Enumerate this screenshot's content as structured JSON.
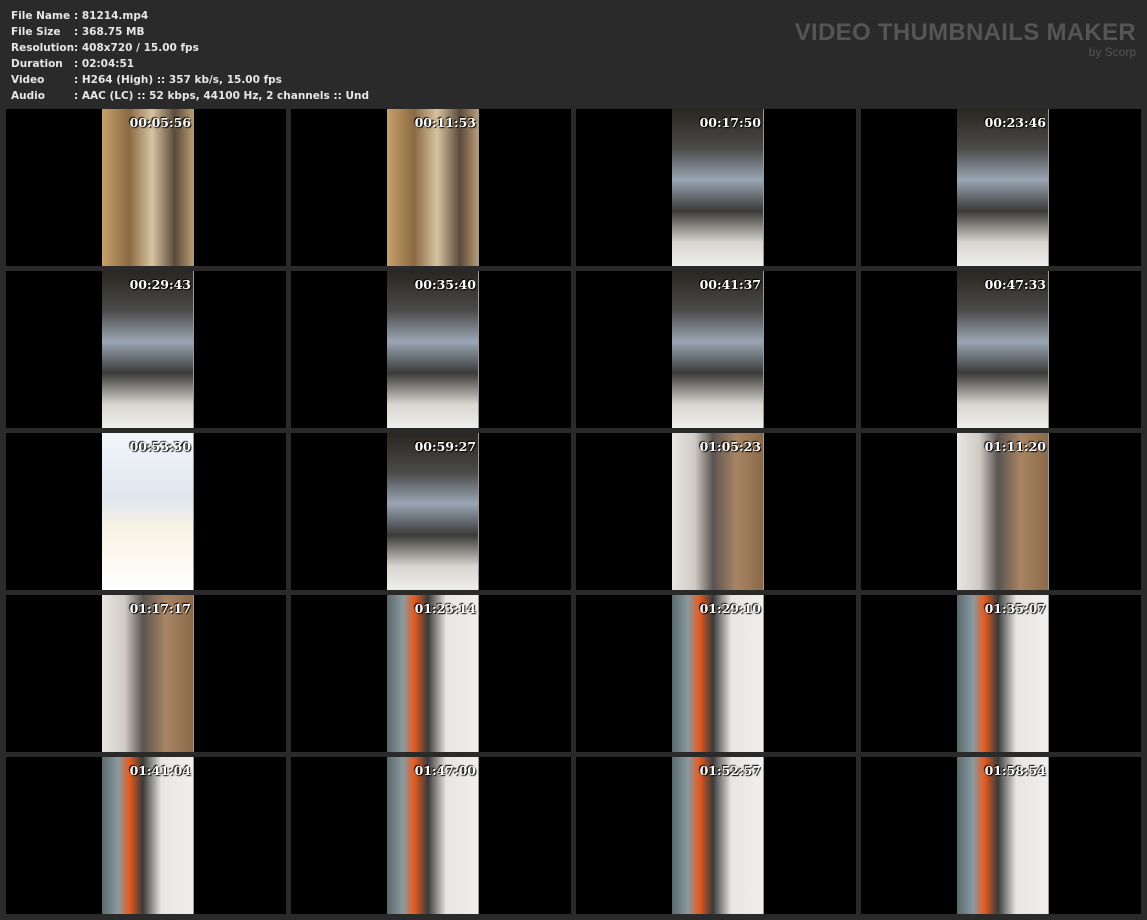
{
  "info": [
    {
      "label": "File Name",
      "value": "81214.mp4"
    },
    {
      "label": "File Size",
      "value": "368.75 MB"
    },
    {
      "label": "Resolution",
      "value": "408x720 / 15.00 fps"
    },
    {
      "label": "Duration",
      "value": "02:04:51"
    },
    {
      "label": "Video",
      "value": "H264 (High) :: 357 kb/s, 15.00 fps"
    },
    {
      "label": "Audio",
      "value": "AAC (LC) :: 52 kbps, 44100 Hz, 2 channels :: Und"
    }
  ],
  "logo": {
    "title": "VIDEO THUMBNAILS MAKER",
    "byline": "by Scorp"
  },
  "thumbnails": [
    {
      "time": "00:05:56",
      "tone": "warm"
    },
    {
      "time": "00:11:53",
      "tone": "warm"
    },
    {
      "time": "00:17:50",
      "tone": "dark"
    },
    {
      "time": "00:23:46",
      "tone": "dark"
    },
    {
      "time": "00:29:43",
      "tone": "dark"
    },
    {
      "time": "00:35:40",
      "tone": "dark"
    },
    {
      "time": "00:41:37",
      "tone": "dark"
    },
    {
      "time": "00:47:33",
      "tone": "dark"
    },
    {
      "time": "00:53:30",
      "tone": "logo"
    },
    {
      "time": "00:59:27",
      "tone": "dark"
    },
    {
      "time": "01:05:23",
      "tone": "room"
    },
    {
      "time": "01:11:20",
      "tone": "room"
    },
    {
      "time": "01:17:17",
      "tone": "room"
    },
    {
      "time": "01:23:14",
      "tone": "bed"
    },
    {
      "time": "01:29:10",
      "tone": "bed"
    },
    {
      "time": "01:35:07",
      "tone": "bed"
    },
    {
      "time": "01:41:04",
      "tone": "bed"
    },
    {
      "time": "01:47:00",
      "tone": "bed"
    },
    {
      "time": "01:52:57",
      "tone": "bed"
    },
    {
      "time": "01:58:54",
      "tone": "bed"
    }
  ],
  "colors": {
    "background": "#2a2a2a",
    "cell": "#000000",
    "text": "#e6e6e6",
    "logo": "#555555"
  }
}
